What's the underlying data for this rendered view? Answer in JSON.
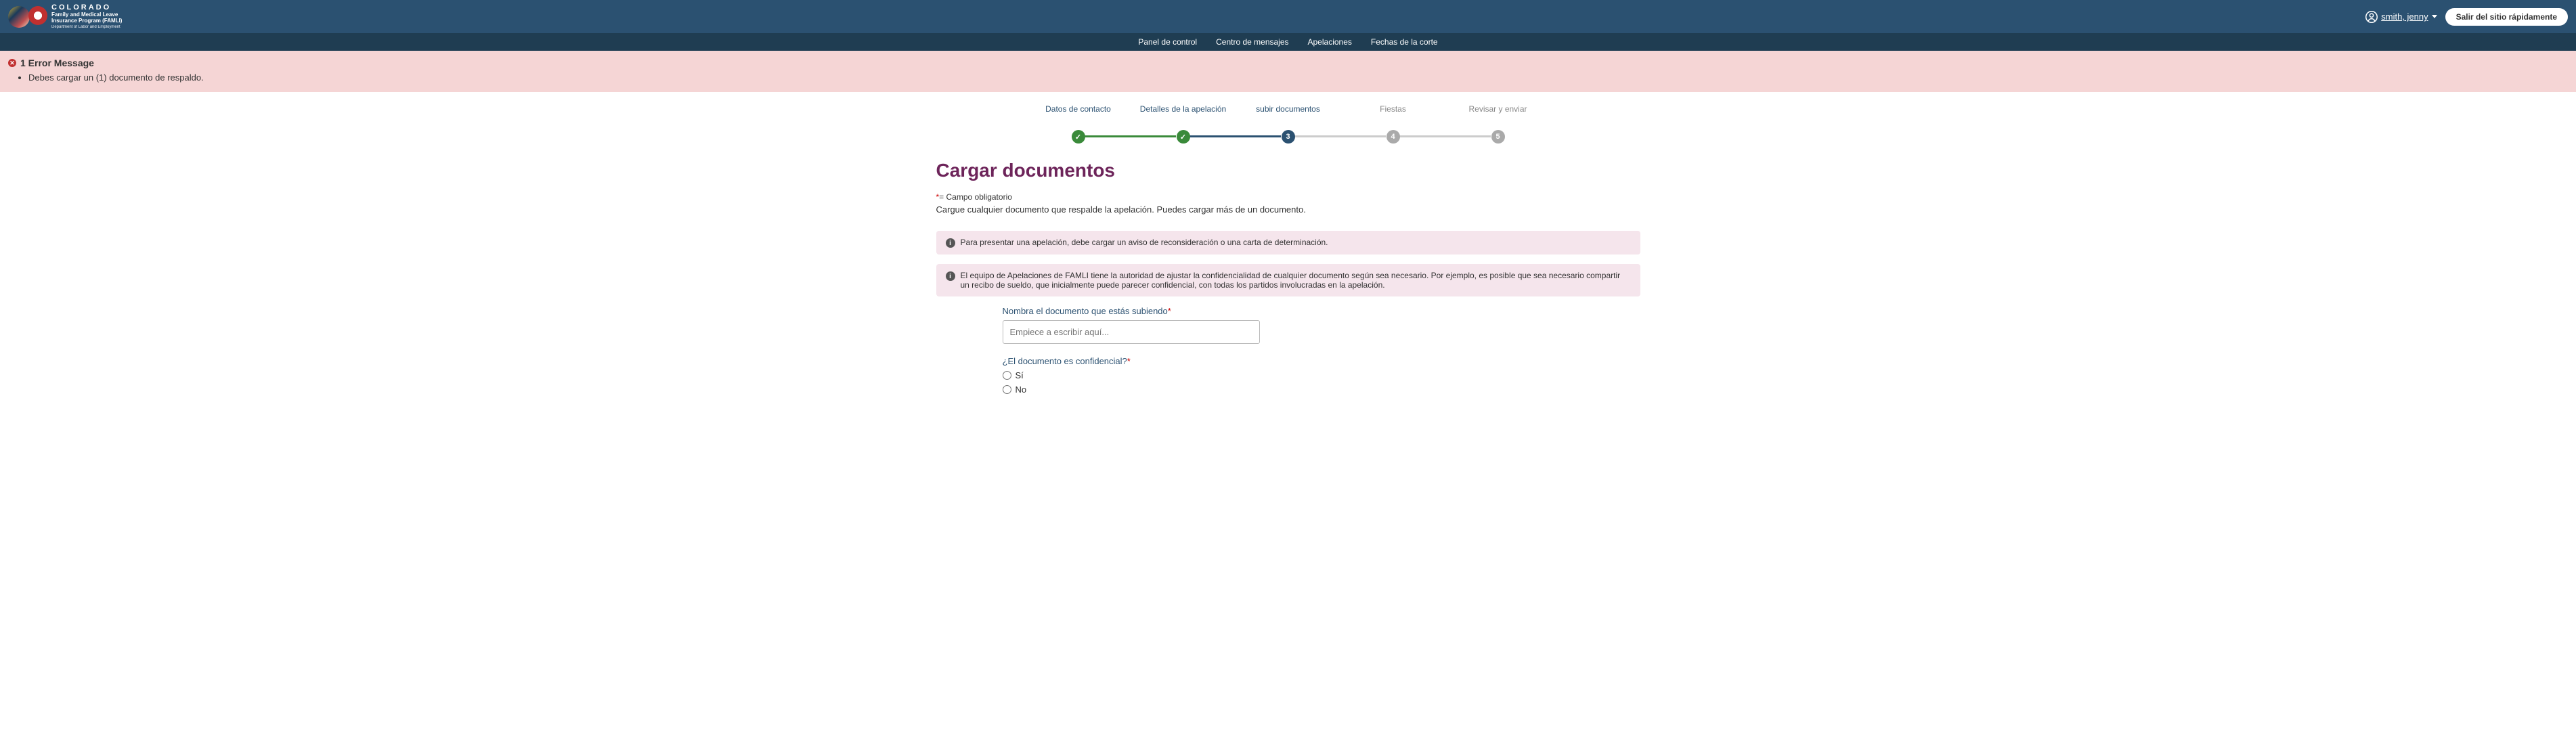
{
  "header": {
    "logo_title": "COLORADO",
    "logo_sub1": "Family and Medical Leave",
    "logo_sub2": "Insurance Program (FAMLI)",
    "logo_dept": "Department of Labor and Employment",
    "user_name": "smith, jenny",
    "quick_exit": "Salir del sitio rápidamente"
  },
  "nav": {
    "items": [
      "Panel de control",
      "Centro de mensajes",
      "Apelaciones",
      "Fechas de la corte"
    ]
  },
  "error": {
    "title": "1 Error Message",
    "items": [
      "Debes cargar un (1) documento de respaldo."
    ]
  },
  "stepper": {
    "steps": [
      {
        "label": "Datos de contacto"
      },
      {
        "label": "Detalles de la apelación"
      },
      {
        "label": "subir documentos",
        "num": "3"
      },
      {
        "label": "Fiestas",
        "num": "4"
      },
      {
        "label": "Revisar y enviar",
        "num": "5"
      }
    ]
  },
  "main": {
    "title": "Cargar documentos",
    "required_symbol": "*",
    "required_text": "= Campo obligatorio",
    "intro": "Cargue cualquier documento que respalde la apelación. Puedes cargar más de un documento.",
    "info1": "Para presentar una apelación, debe cargar un aviso de reconsideración o una carta de determinación.",
    "info2": "El equipo de Apelaciones de FAMLI tiene la autoridad de ajustar la confidencialidad de cualquier documento según sea necesario. Por ejemplo, es posible que sea necesario compartir un recibo de sueldo, que inicialmente puede parecer confidencial, con todas los partidos involucradas en la apelación.",
    "doc_name_label": "Nombra el documento que estás subiendo",
    "doc_name_placeholder": "Empiece a escribir aquí...",
    "confidential_label": "¿El documento es confidencial?",
    "radio_yes": "Sí",
    "radio_no": "No"
  }
}
